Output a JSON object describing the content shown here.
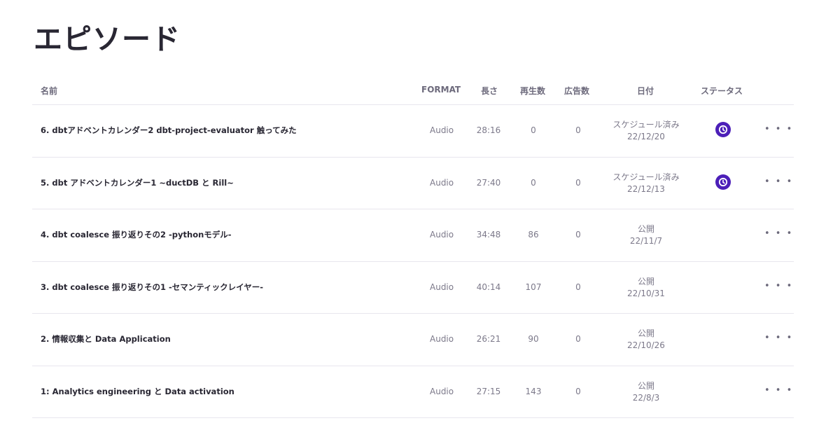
{
  "page": {
    "title": "エピソード"
  },
  "columns": {
    "name": "名前",
    "format": "FORMAT",
    "length": "長さ",
    "plays": "再生数",
    "ads": "広告数",
    "date": "日付",
    "status": "ステータス"
  },
  "colors": {
    "accent": "#4c1fb8",
    "text": "#292733",
    "muted": "#7c798a",
    "divider": "#e8e6ee"
  },
  "more_label": "• • •",
  "episodes": [
    {
      "name": "6. dbtアドベントカレンダー2 dbt-project-evaluator 触ってみた",
      "format": "Audio",
      "length": "28:16",
      "plays": "0",
      "ads": "0",
      "date_status": "スケジュール済み",
      "date": "22/12/20",
      "status_icon": "clock-icon",
      "scheduled": true
    },
    {
      "name": "5. dbt アドベントカレンダー1 ~ductDB と Rill~",
      "format": "Audio",
      "length": "27:40",
      "plays": "0",
      "ads": "0",
      "date_status": "スケジュール済み",
      "date": "22/12/13",
      "status_icon": "clock-icon",
      "scheduled": true
    },
    {
      "name": "4. dbt coalesce 振り返りその2 -pythonモデル-",
      "format": "Audio",
      "length": "34:48",
      "plays": "86",
      "ads": "0",
      "date_status": "公開",
      "date": "22/11/7",
      "scheduled": false
    },
    {
      "name": "3. dbt coalesce 振り返りその1 -セマンティックレイヤー-",
      "format": "Audio",
      "length": "40:14",
      "plays": "107",
      "ads": "0",
      "date_status": "公開",
      "date": "22/10/31",
      "scheduled": false
    },
    {
      "name": "2. 情報収集と Data Application",
      "format": "Audio",
      "length": "26:21",
      "plays": "90",
      "ads": "0",
      "date_status": "公開",
      "date": "22/10/26",
      "scheduled": false
    },
    {
      "name": "1: Analytics engineering と Data activation",
      "format": "Audio",
      "length": "27:15",
      "plays": "143",
      "ads": "0",
      "date_status": "公開",
      "date": "22/8/3",
      "scheduled": false
    }
  ]
}
